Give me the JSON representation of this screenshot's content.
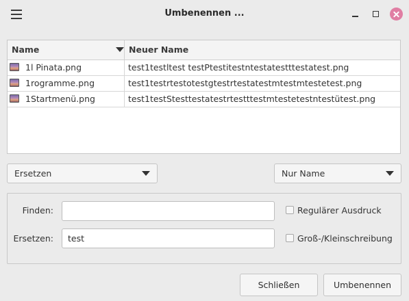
{
  "window": {
    "title": "Umbenennen ...",
    "icons": [
      "menu-icon",
      "minimize-icon",
      "maximize-icon",
      "close-icon"
    ],
    "close_color": "#e07ea3"
  },
  "table": {
    "columns": [
      "Name",
      "Neuer Name"
    ],
    "sorted_by": "Name",
    "rows": [
      {
        "name": "1l Pinata.png",
        "new_name": "test1testltest testPtestitestntestatestttestatest.png"
      },
      {
        "name": "1rogramme.png",
        "new_name": "test1testrtestotestgtestrtestatestmtestmtestetest.png"
      },
      {
        "name": "1Startmenü.png",
        "new_name": "test1testStesttestatestrtestttestmtestetestntestütest.png"
      }
    ]
  },
  "mode_select": {
    "value": "Ersetzen"
  },
  "scope_select": {
    "value": "Nur Name"
  },
  "find": {
    "label": "Finden:",
    "value": ""
  },
  "replace": {
    "label": "Ersetzen:",
    "value": "test"
  },
  "options": {
    "regex_label": "Regulärer Ausdruck",
    "regex_checked": false,
    "case_label": "Groß-/Kleinschreibung",
    "case_checked": false
  },
  "buttons": {
    "close": "Schließen",
    "rename": "Umbenennen"
  }
}
